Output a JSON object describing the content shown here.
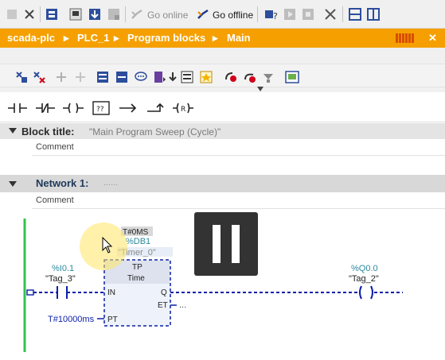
{
  "toolbar": {
    "go_online_label": "Go online",
    "go_offline_label": "Go offline"
  },
  "breadcrumb": {
    "items": [
      "scada-plc",
      "PLC_1",
      "Program blocks",
      "Main"
    ],
    "separator": "▸"
  },
  "editor": {
    "block_title_label": "Block title:",
    "block_title_value": "\"Main Program Sweep (Cycle)\"",
    "comment_label": "Comment",
    "network_label": "Network 1:",
    "network_title_placeholder": "......",
    "network_comment_label": "Comment"
  },
  "ladder": {
    "timer": {
      "db_tag": "%DB1",
      "instance_name": "\"Timer_0\"",
      "constant_label": "T#0MS",
      "type": "TP",
      "data_type": "Time",
      "in_pin": "IN",
      "q_pin": "Q",
      "pt_pin": "PT",
      "et_pin": "ET",
      "et_value": "...",
      "pt_value": "T#10000ms"
    },
    "contact": {
      "address": "%I0.1",
      "tag": "\"Tag_3\""
    },
    "coil": {
      "address": "%Q0.0",
      "tag": "\"Tag_2\""
    }
  },
  "colors": {
    "accent": "#f5a000",
    "ladder_blue": "#0a1fa8",
    "power_rail": "#34c34a",
    "address_teal": "#2d8a9e"
  }
}
